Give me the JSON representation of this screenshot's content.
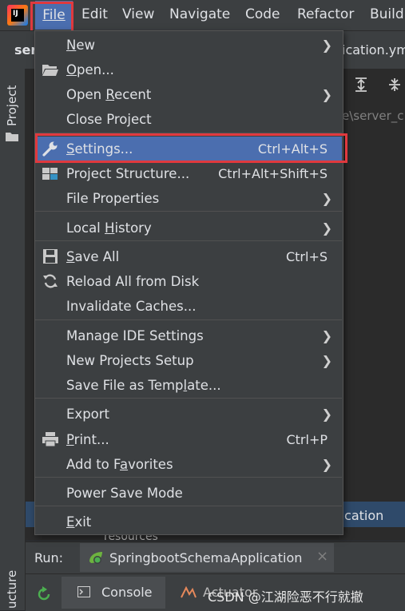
{
  "menubar": {
    "logo_text": "IJ",
    "items": [
      "File",
      "Edit",
      "View",
      "Navigate",
      "Code",
      "Refactor",
      "Build"
    ]
  },
  "tabstrip": {
    "left_tab": "ser",
    "right_tab": "ication.ym"
  },
  "sidebar": {
    "project_label": "Project",
    "structure_label": "ucture"
  },
  "editor": {
    "path_text": "e\\server_c",
    "selected_row_text": "plication",
    "resources_text": "resources"
  },
  "file_menu": {
    "items": [
      {
        "label": "New",
        "mnemonic": "N",
        "rest": "ew",
        "shortcut": "",
        "submenu": true,
        "icon": ""
      },
      {
        "label": "Open...",
        "mnemonic": "O",
        "rest": "pen...",
        "shortcut": "",
        "submenu": false,
        "icon": "folder-open-icon"
      },
      {
        "label": "Open Recent",
        "pre": "Open ",
        "mnemonic": "R",
        "rest": "ecent",
        "shortcut": "",
        "submenu": true,
        "icon": ""
      },
      {
        "label": "Close Project",
        "shortcut": "",
        "submenu": false,
        "icon": ""
      },
      {
        "label": "Settings...",
        "mnemonic": "S",
        "rest": "ettings...",
        "shortcut": "Ctrl+Alt+S",
        "submenu": false,
        "icon": "wrench-icon"
      },
      {
        "label": "Project Structure...",
        "shortcut": "Ctrl+Alt+Shift+S",
        "submenu": false,
        "icon": "project-structure-icon"
      },
      {
        "label": "File Properties",
        "shortcut": "",
        "submenu": true,
        "icon": ""
      },
      {
        "label": "Local History",
        "pre": "Local ",
        "mnemonic": "H",
        "rest": "istory",
        "shortcut": "",
        "submenu": true,
        "icon": ""
      },
      {
        "label": "Save All",
        "mnemonic": "S",
        "rest": "ave All",
        "shortcut": "Ctrl+S",
        "submenu": false,
        "icon": "save-icon"
      },
      {
        "label": "Reload All from Disk",
        "shortcut": "",
        "submenu": false,
        "icon": "reload-icon"
      },
      {
        "label": "Invalidate Caches...",
        "shortcut": "",
        "submenu": false,
        "icon": ""
      },
      {
        "label": "Manage IDE Settings",
        "shortcut": "",
        "submenu": true,
        "icon": ""
      },
      {
        "label": "New Projects Setup",
        "shortcut": "",
        "submenu": true,
        "icon": ""
      },
      {
        "label": "Save File as Template...",
        "pre": "Save File as Temp",
        "mnemonic": "l",
        "rest": "ate...",
        "shortcut": "",
        "submenu": false,
        "icon": ""
      },
      {
        "label": "Export",
        "shortcut": "",
        "submenu": true,
        "icon": ""
      },
      {
        "label": "Print...",
        "mnemonic": "P",
        "rest": "rint...",
        "shortcut": "Ctrl+P",
        "submenu": false,
        "icon": "printer-icon"
      },
      {
        "label": "Add to Favorites",
        "pre": "Add to F",
        "mnemonic": "a",
        "rest": "vorites",
        "shortcut": "",
        "submenu": true,
        "icon": ""
      },
      {
        "label": "Power Save Mode",
        "shortcut": "",
        "submenu": false,
        "icon": ""
      },
      {
        "label": "Exit",
        "mnemonic": "E",
        "rest": "xit",
        "shortcut": "",
        "submenu": false,
        "icon": ""
      }
    ]
  },
  "run": {
    "label": "Run:",
    "tab_title": "SpringbootSchemaApplication",
    "close_glyph": "×"
  },
  "bottom": {
    "console_label": "Console",
    "actuator_label": "Actuator"
  },
  "watermark": "CSDN @江湖险恶不行就撤"
}
